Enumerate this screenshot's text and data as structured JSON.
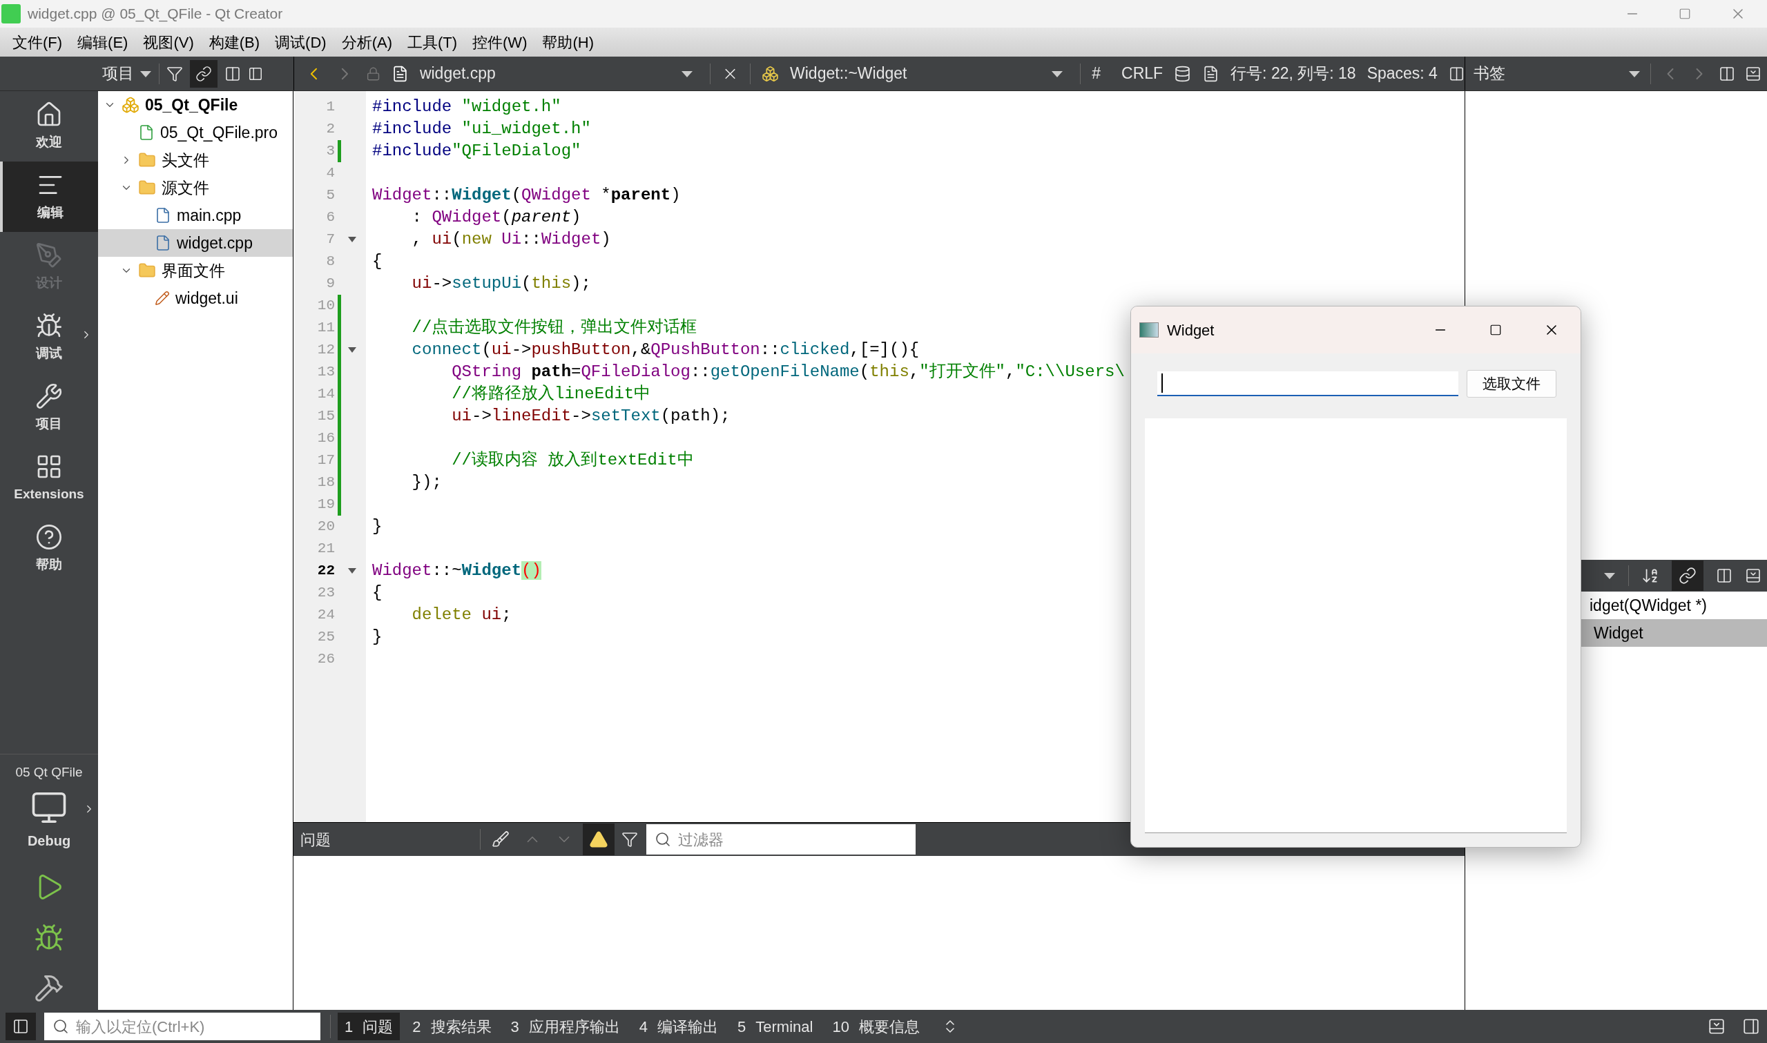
{
  "window": {
    "title": "widget.cpp @ 05_Qt_QFile - Qt Creator"
  },
  "menu": [
    "文件(F)",
    "编辑(E)",
    "视图(V)",
    "构建(B)",
    "调试(D)",
    "分析(A)",
    "工具(T)",
    "控件(W)",
    "帮助(H)"
  ],
  "project_toolbar": {
    "view": "项目",
    "link_on": true
  },
  "editor_toolbar": {
    "file": "widget.cpp",
    "symbol": "Widget::~Widget",
    "hash": "#",
    "line_ending": "CRLF",
    "position": "行号: 22, 列号: 18",
    "indent": "Spaces: 4"
  },
  "bookmarks_toolbar": {
    "title": "书签"
  },
  "mode_bar": {
    "items": [
      {
        "label": "欢迎",
        "kind": "welcome",
        "selected": false,
        "disabled": false
      },
      {
        "label": "编辑",
        "kind": "edit",
        "selected": true,
        "disabled": false
      },
      {
        "label": "设计",
        "kind": "design",
        "selected": false,
        "disabled": true
      },
      {
        "label": "调试",
        "kind": "debug",
        "selected": false,
        "disabled": false
      },
      {
        "label": "项目",
        "kind": "projects",
        "selected": false,
        "disabled": false
      },
      {
        "label": "Extensions",
        "kind": "extensions",
        "selected": false,
        "disabled": false
      },
      {
        "label": "帮助",
        "kind": "help",
        "selected": false,
        "disabled": false
      }
    ],
    "project": "05 Qt QFile",
    "build_config": "Debug"
  },
  "project_tree": [
    {
      "label": "05_Qt_QFile",
      "kind": "project",
      "expanded": true,
      "selected": false,
      "children": [
        {
          "label": "05_Qt_QFile.pro",
          "kind": "pro",
          "selected": false
        },
        {
          "label": "头文件",
          "kind": "headers",
          "expanded": false,
          "selected": false
        },
        {
          "label": "源文件",
          "kind": "sources",
          "expanded": true,
          "selected": false,
          "children": [
            {
              "label": "main.cpp",
              "kind": "cpp",
              "selected": false
            },
            {
              "label": "widget.cpp",
              "kind": "cpp",
              "selected": true
            }
          ]
        },
        {
          "label": "界面文件",
          "kind": "forms",
          "expanded": true,
          "selected": false,
          "children": [
            {
              "label": "widget.ui",
              "kind": "ui",
              "selected": false
            }
          ]
        }
      ]
    }
  ],
  "code_lines": [
    {
      "number": "1",
      "changed": false,
      "fold": false,
      "current": false,
      "tokens": [
        {
          "text": "#include",
          "kind": "pre"
        },
        {
          "text": " \"widget.h\"",
          "kind": "str"
        }
      ]
    },
    {
      "number": "2",
      "changed": false,
      "fold": false,
      "current": false,
      "tokens": [
        {
          "text": "#include",
          "kind": "pre"
        },
        {
          "text": " \"ui_widget.h\"",
          "kind": "str"
        }
      ]
    },
    {
      "number": "3",
      "changed": true,
      "fold": false,
      "current": false,
      "tokens": [
        {
          "text": "#include",
          "kind": "pre"
        },
        {
          "text": "\"QFileDialog\"",
          "kind": "str"
        }
      ]
    },
    {
      "number": "4",
      "changed": false,
      "fold": false,
      "current": false
    },
    {
      "number": "5",
      "changed": false,
      "fold": false,
      "current": false,
      "tokens": [
        {
          "text": "Widget",
          "kind": "type"
        },
        {
          "text": "::",
          "kind": "plain"
        },
        {
          "text": "Widget",
          "kind": "decl"
        },
        {
          "text": "(",
          "kind": "plain"
        },
        {
          "text": "QWidget",
          "kind": "type"
        },
        {
          "text": " *",
          "kind": "plain"
        },
        {
          "text": "parent",
          "kind": "bold"
        },
        {
          "text": ")",
          "kind": "plain"
        }
      ]
    },
    {
      "number": "6",
      "changed": false,
      "fold": false,
      "current": false,
      "tokens": [
        {
          "text": "    : ",
          "kind": "plain"
        },
        {
          "text": "QWidget",
          "kind": "type"
        },
        {
          "text": "(",
          "kind": "plain"
        },
        {
          "text": "parent",
          "kind": "italic"
        },
        {
          "text": ")",
          "kind": "plain"
        }
      ]
    },
    {
      "number": "7",
      "changed": false,
      "fold": true,
      "current": false,
      "tokens": [
        {
          "text": "    , ",
          "kind": "plain"
        },
        {
          "text": "ui",
          "kind": "member"
        },
        {
          "text": "(",
          "kind": "plain"
        },
        {
          "text": "new",
          "kind": "kw"
        },
        {
          "text": " Ui",
          "kind": "type"
        },
        {
          "text": "::",
          "kind": "plain"
        },
        {
          "text": "Widget",
          "kind": "type"
        },
        {
          "text": ")",
          "kind": "plain"
        }
      ]
    },
    {
      "number": "8",
      "changed": false,
      "fold": false,
      "current": false,
      "tokens": [
        {
          "text": "{",
          "kind": "plain"
        }
      ]
    },
    {
      "number": "9",
      "changed": false,
      "fold": false,
      "current": false,
      "tokens": [
        {
          "text": "    ui",
          "kind": "member"
        },
        {
          "text": "->",
          "kind": "plain"
        },
        {
          "text": "setupUi",
          "kind": "func"
        },
        {
          "text": "(",
          "kind": "plain"
        },
        {
          "text": "this",
          "kind": "kw"
        },
        {
          "text": ");",
          "kind": "plain"
        }
      ]
    },
    {
      "number": "10",
      "changed": true,
      "fold": false,
      "current": false
    },
    {
      "number": "11",
      "changed": true,
      "fold": false,
      "current": false,
      "tokens": [
        {
          "text": "    //点击选取文件按钮，弹出文件对话框",
          "kind": "comment"
        }
      ]
    },
    {
      "number": "12",
      "changed": true,
      "fold": true,
      "current": false,
      "tokens": [
        {
          "text": "    connect",
          "kind": "func"
        },
        {
          "text": "(",
          "kind": "plain"
        },
        {
          "text": "ui",
          "kind": "member"
        },
        {
          "text": "->",
          "kind": "plain"
        },
        {
          "text": "pushButton",
          "kind": "member"
        },
        {
          "text": ",&",
          "kind": "plain"
        },
        {
          "text": "QPushButton",
          "kind": "type"
        },
        {
          "text": "::",
          "kind": "plain"
        },
        {
          "text": "clicked",
          "kind": "func"
        },
        {
          "text": ",[=](){",
          "kind": "plain"
        }
      ]
    },
    {
      "number": "13",
      "changed": true,
      "fold": false,
      "current": false,
      "tokens": [
        {
          "text": "        QString",
          "kind": "type"
        },
        {
          "text": " path",
          "kind": "bold"
        },
        {
          "text": "=",
          "kind": "plain"
        },
        {
          "text": "QFileDialog",
          "kind": "type"
        },
        {
          "text": "::",
          "kind": "plain"
        },
        {
          "text": "getOpenFileName",
          "kind": "func"
        },
        {
          "text": "(",
          "kind": "plain"
        },
        {
          "text": "this",
          "kind": "kw"
        },
        {
          "text": ",",
          "kind": "plain"
        },
        {
          "text": "\"打开文件\"",
          "kind": "str"
        },
        {
          "text": ",",
          "kind": "plain"
        },
        {
          "text": "\"C:\\\\Users\\",
          "kind": "str"
        }
      ]
    },
    {
      "number": "14",
      "changed": true,
      "fold": false,
      "current": false,
      "tokens": [
        {
          "text": "        //将路径放入lineEdit中",
          "kind": "comment"
        }
      ]
    },
    {
      "number": "15",
      "changed": true,
      "fold": false,
      "current": false,
      "tokens": [
        {
          "text": "        ui",
          "kind": "member"
        },
        {
          "text": "->",
          "kind": "plain"
        },
        {
          "text": "lineEdit",
          "kind": "member"
        },
        {
          "text": "->",
          "kind": "plain"
        },
        {
          "text": "setText",
          "kind": "func"
        },
        {
          "text": "(path);",
          "kind": "plain"
        }
      ]
    },
    {
      "number": "16",
      "changed": true,
      "fold": false,
      "current": false
    },
    {
      "number": "17",
      "changed": true,
      "fold": false,
      "current": false,
      "tokens": [
        {
          "text": "        //读取内容 放入到textEdit中",
          "kind": "comment"
        }
      ]
    },
    {
      "number": "18",
      "changed": true,
      "fold": false,
      "current": false,
      "tokens": [
        {
          "text": "    });",
          "kind": "plain"
        }
      ]
    },
    {
      "number": "19",
      "changed": true,
      "fold": false,
      "current": false
    },
    {
      "number": "20",
      "changed": false,
      "fold": false,
      "current": false,
      "tokens": [
        {
          "text": "}",
          "kind": "plain"
        }
      ]
    },
    {
      "number": "21",
      "changed": false,
      "fold": false,
      "current": false
    },
    {
      "number": "22",
      "changed": false,
      "fold": true,
      "current": true,
      "tokens": [
        {
          "text": "Widget",
          "kind": "type"
        },
        {
          "text": "::~",
          "kind": "plain"
        },
        {
          "text": "Widget",
          "kind": "decl"
        },
        {
          "text": "()",
          "kind": "match"
        }
      ]
    },
    {
      "number": "23",
      "changed": false,
      "fold": false,
      "current": false,
      "tokens": [
        {
          "text": "{",
          "kind": "plain"
        }
      ]
    },
    {
      "number": "24",
      "changed": false,
      "fold": false,
      "current": false,
      "tokens": [
        {
          "text": "    delete",
          "kind": "kw"
        },
        {
          "text": " ui",
          "kind": "member"
        },
        {
          "text": ";",
          "kind": "plain"
        }
      ]
    },
    {
      "number": "25",
      "changed": false,
      "fold": false,
      "current": false,
      "tokens": [
        {
          "text": "}",
          "kind": "plain"
        }
      ]
    },
    {
      "number": "26",
      "changed": false,
      "fold": false,
      "current": false
    }
  ],
  "issues_pane": {
    "title": "问题",
    "show_warnings": true,
    "filter_placeholder": "过滤器"
  },
  "outline": {
    "link_on": true,
    "rows": [
      {
        "text": "idget(QWidget *)",
        "selected": false
      },
      {
        "text": "Widget",
        "selected": true
      }
    ]
  },
  "status_bar": {
    "locator_placeholder": "输入以定位(Ctrl+K)",
    "tabs": [
      {
        "number": "1",
        "label": "问题",
        "selected": true
      },
      {
        "number": "2",
        "label": "搜索结果",
        "selected": false
      },
      {
        "number": "3",
        "label": "应用程序输出",
        "selected": false
      },
      {
        "number": "4",
        "label": "编译输出",
        "selected": false
      },
      {
        "number": "5",
        "label": "Terminal",
        "selected": false
      },
      {
        "number": "10",
        "label": "概要信息",
        "selected": false
      }
    ]
  },
  "dialog": {
    "title": "Widget",
    "button": "选取文件"
  }
}
